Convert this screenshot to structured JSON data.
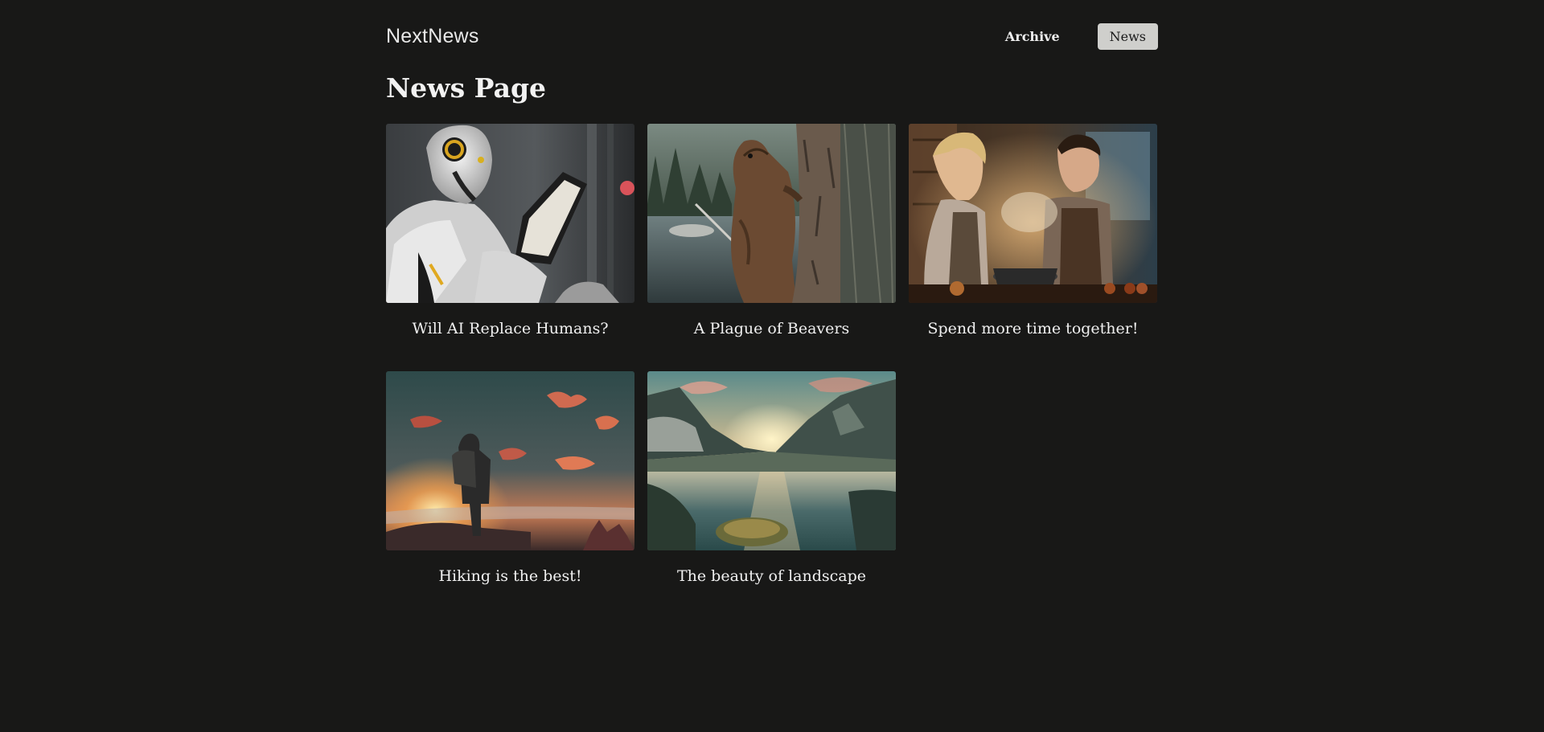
{
  "header": {
    "logo": "NextNews",
    "nav": [
      {
        "label": "Archive",
        "active": false
      },
      {
        "label": "News",
        "active": true
      }
    ]
  },
  "main": {
    "title": "News Page",
    "articles": [
      {
        "title": "Will AI Replace Humans?",
        "image": "robot-reading-tablet"
      },
      {
        "title": "A Plague of Beavers",
        "image": "beaver-on-tree"
      },
      {
        "title": "Spend more time together!",
        "image": "couple-cooking"
      },
      {
        "title": "Hiking is the best!",
        "image": "hiker-at-sunset"
      },
      {
        "title": "The beauty of landscape",
        "image": "mountain-lake-landscape"
      }
    ]
  },
  "colors": {
    "background": "#181817",
    "text": "#ebebeb",
    "active_nav_bg": "#cfcfcc",
    "active_nav_text": "#1a1a1a"
  }
}
